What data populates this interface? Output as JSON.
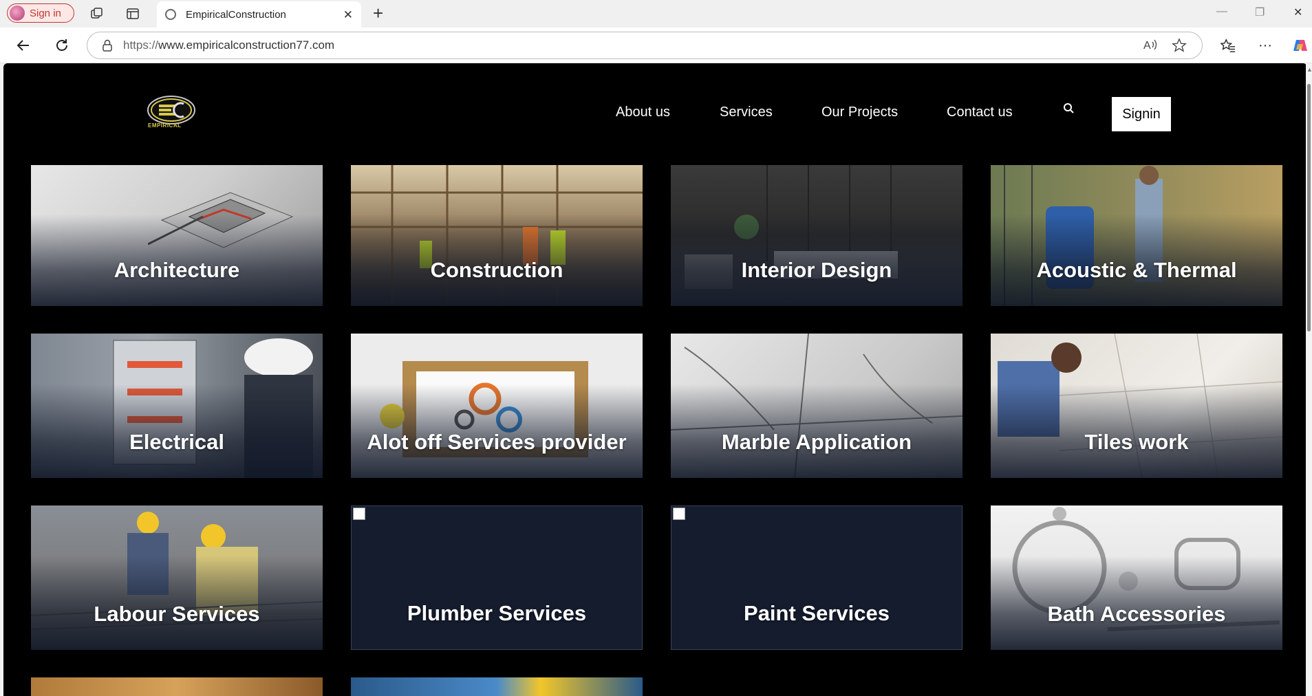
{
  "browser": {
    "profile_label": "Sign in",
    "tab_title": "EmpiricalConstruction",
    "url_scheme": "https://",
    "url_host": "www.empiricalconstruction77.com"
  },
  "site": {
    "logo_text": "EMPIRICAL",
    "nav": {
      "about": "About us",
      "services": "Services",
      "projects": "Our Projects",
      "contact": "Contact us",
      "signin": "Signin"
    },
    "cards": [
      {
        "title": "Architecture"
      },
      {
        "title": "Construction"
      },
      {
        "title": "Interior Design"
      },
      {
        "title": "Acoustic & Thermal"
      },
      {
        "title": "Electrical"
      },
      {
        "title": "Alot off Services provider"
      },
      {
        "title": "Marble Application"
      },
      {
        "title": "Tiles work"
      },
      {
        "title": "Labour Services"
      },
      {
        "title": "Plumber Services"
      },
      {
        "title": "Paint Services"
      },
      {
        "title": "Bath Accessories"
      }
    ]
  },
  "colors": {
    "page_bg": "#000000",
    "card_bg": "#141c2e",
    "profile_accent": "#c0392b"
  }
}
